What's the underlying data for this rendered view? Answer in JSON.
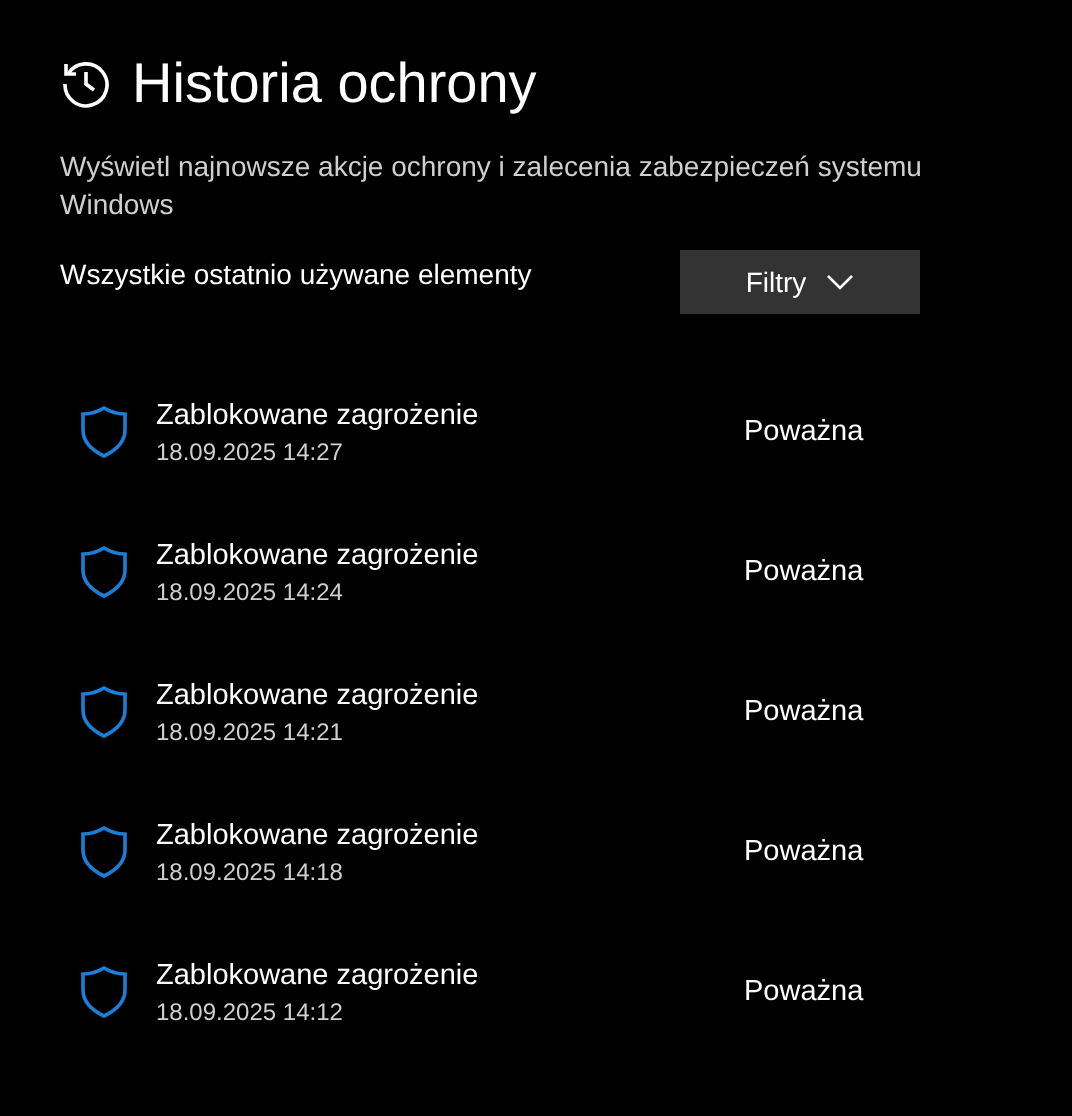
{
  "title": "Historia ochrony",
  "description": "Wyświetl najnowsze akcje ochrony i zalecenia zabezpieczeń systemu Windows",
  "filter_label": "Wszystkie ostatnio używane elementy",
  "filter_button": "Filtry",
  "items": [
    {
      "title": "Zablokowane zagrożenie",
      "date": "18.09.2025 14:27",
      "severity": "Poważna"
    },
    {
      "title": "Zablokowane zagrożenie",
      "date": "18.09.2025 14:24",
      "severity": "Poważna"
    },
    {
      "title": "Zablokowane zagrożenie",
      "date": "18.09.2025 14:21",
      "severity": "Poważna"
    },
    {
      "title": "Zablokowane zagrożenie",
      "date": "18.09.2025 14:18",
      "severity": "Poważna"
    },
    {
      "title": "Zablokowane zagrożenie",
      "date": "18.09.2025 14:12",
      "severity": "Poważna"
    }
  ]
}
